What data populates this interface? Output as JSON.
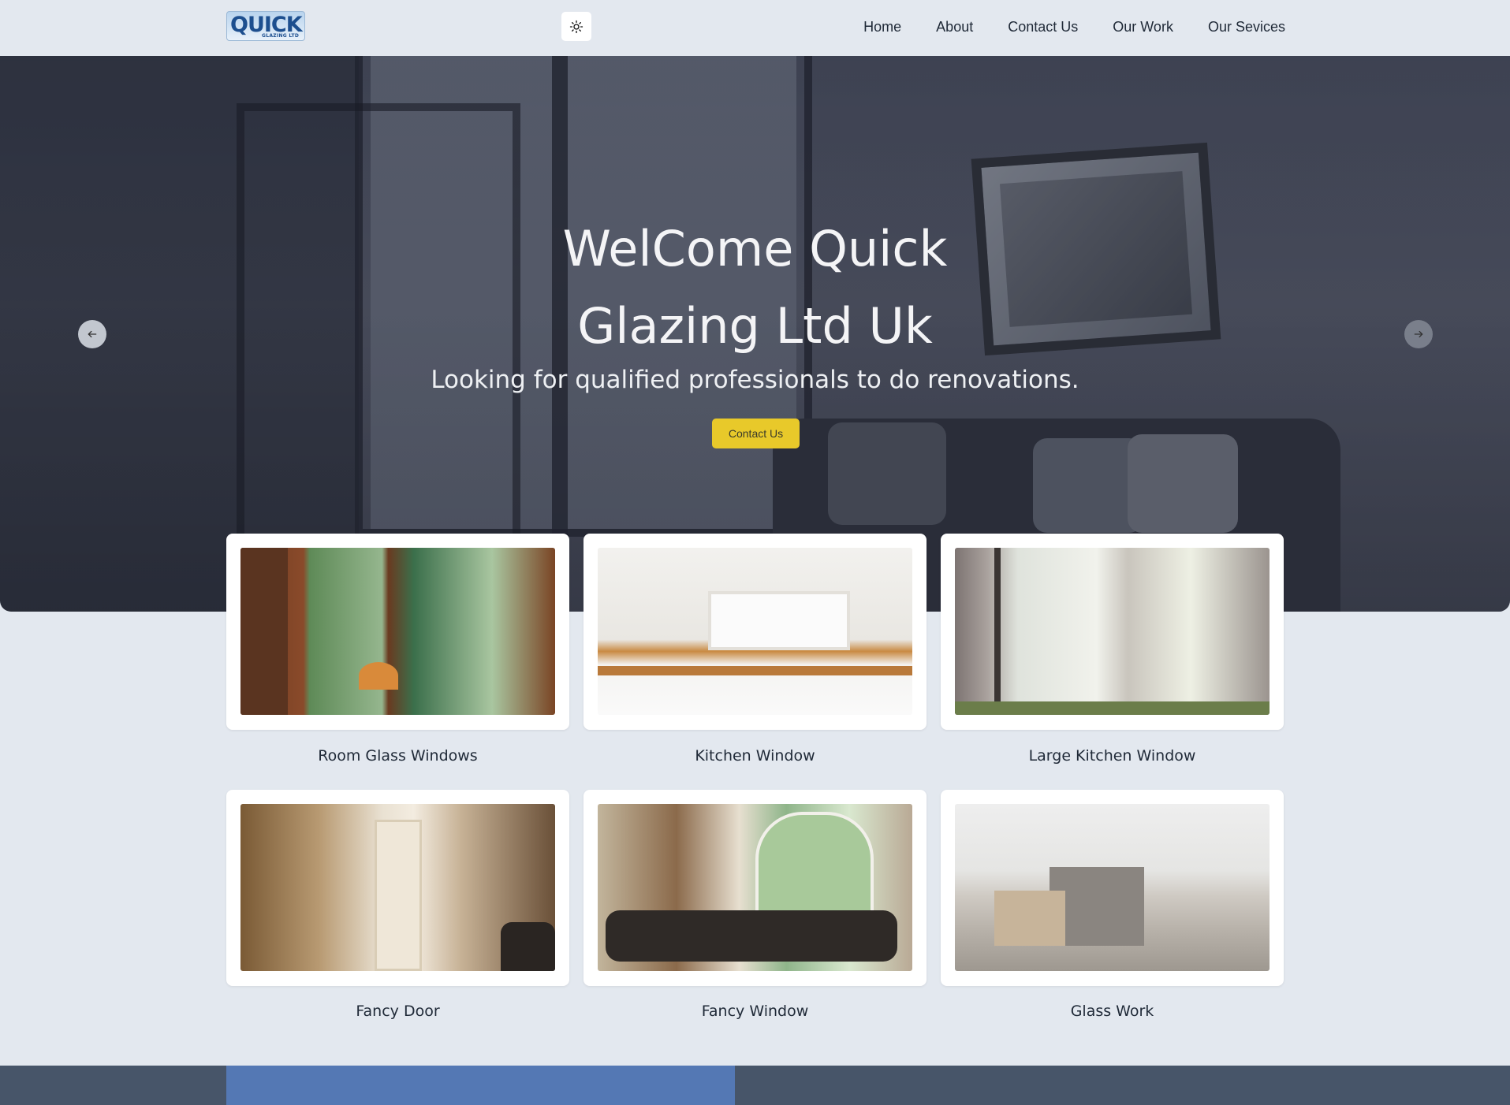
{
  "header": {
    "logo_text": "QUICK",
    "logo_subtext": "GLAZING LTD",
    "theme_toggle_icon": "sun-icon",
    "nav": [
      "Home",
      "About",
      "Contact Us",
      "Our Work",
      "Our Sevices"
    ]
  },
  "hero": {
    "title_line1": "WelCome Quick",
    "title_line2": "Glazing Ltd Uk",
    "subtitle": "Looking for qualified professionals to do renovations.",
    "cta_label": "Contact Us",
    "prev_icon": "arrow-left-icon",
    "next_icon": "arrow-right-icon"
  },
  "cards": [
    {
      "label": "Room Glass Windows"
    },
    {
      "label": "Kitchen Window"
    },
    {
      "label": "Large Kitchen Window"
    },
    {
      "label": "Fancy Door"
    },
    {
      "label": "Fancy Window"
    },
    {
      "label": "Glass Work"
    }
  ],
  "colors": {
    "background": "#e3e8ef",
    "cta": "#e8c92a",
    "footer": "#475569",
    "footer_accent": "#5478b4"
  }
}
